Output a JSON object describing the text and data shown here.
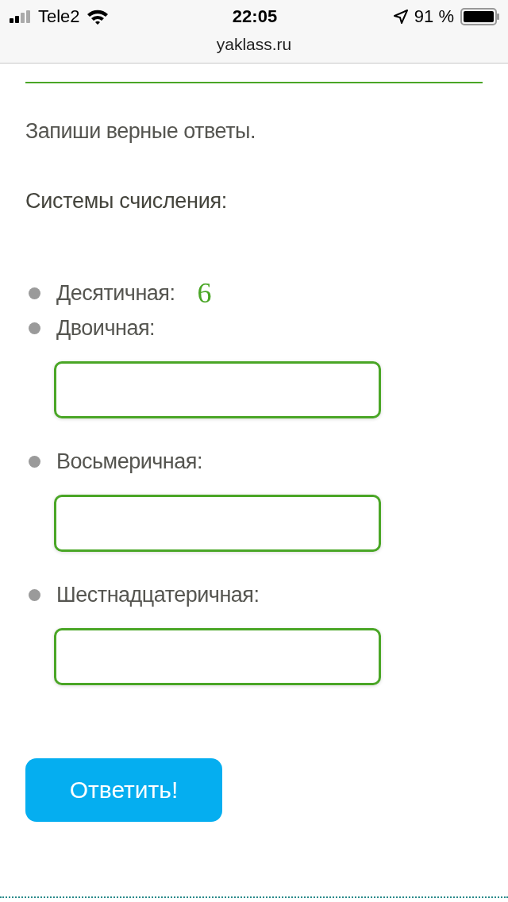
{
  "status_bar": {
    "carrier": "Tele2",
    "time": "22:05",
    "battery": "91 %"
  },
  "address_bar": {
    "url": "yaklass.ru"
  },
  "task": {
    "instruction": "Запиши верные ответы.",
    "heading": "Системы счисления:",
    "items": [
      {
        "kind": "value",
        "label": "Десятичная:",
        "value": "6"
      },
      {
        "kind": "input",
        "label": "Двоичная:"
      },
      {
        "kind": "input",
        "label": "Восьмеричная:"
      },
      {
        "kind": "input",
        "label": "Шестнадцатеричная:"
      }
    ]
  },
  "submit_button": "Ответить!"
}
